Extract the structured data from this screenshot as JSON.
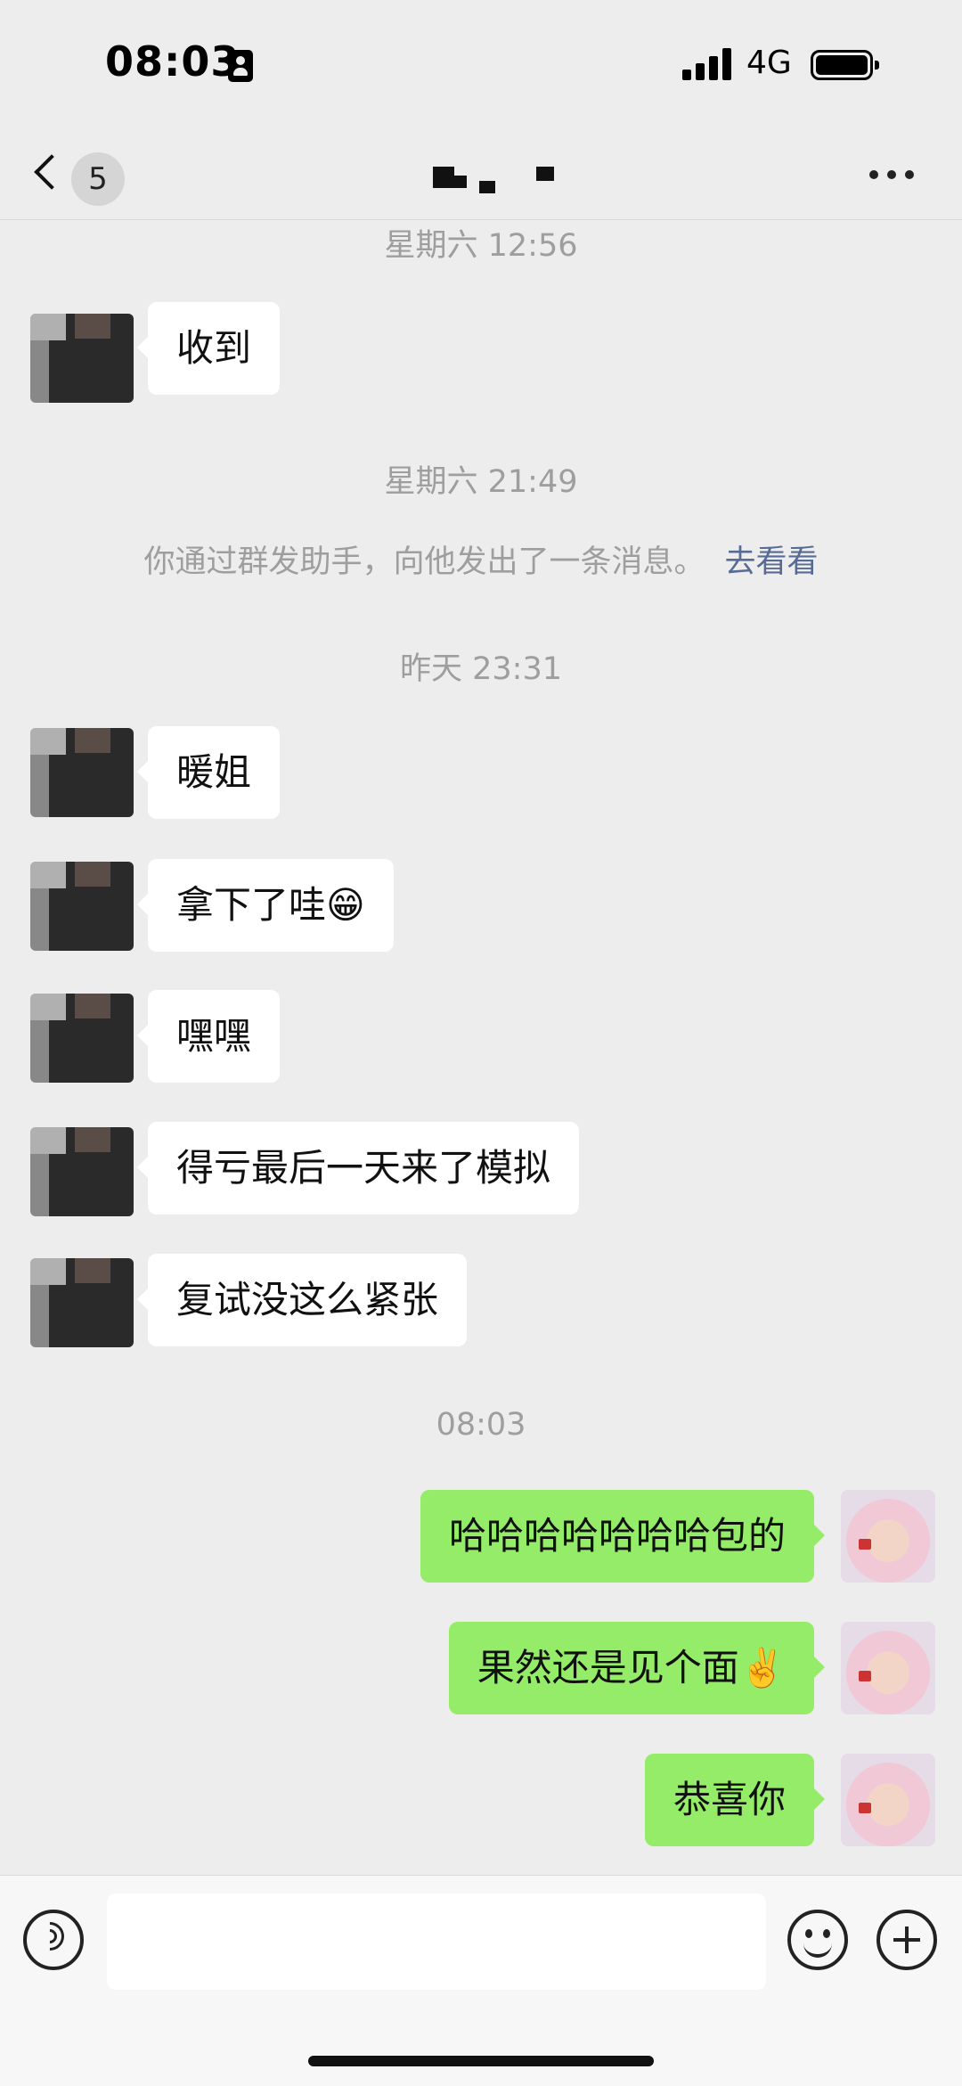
{
  "status_bar": {
    "time": "08:03",
    "network": "4G",
    "icons": [
      "id-card-icon",
      "signal-icon",
      "battery-icon"
    ]
  },
  "nav": {
    "unread_count": "5",
    "icons": [
      "back-arrow-icon",
      "more-icon"
    ]
  },
  "messages": [
    {
      "kind": "time",
      "text": "星期六 12:56"
    },
    {
      "kind": "in",
      "text": "收到"
    },
    {
      "kind": "time",
      "text": "星期六 21:49"
    },
    {
      "kind": "system",
      "text": "你通过群发助手，向他发出了一条消息。",
      "link": "去看看"
    },
    {
      "kind": "time",
      "text": "昨天 23:31"
    },
    {
      "kind": "in",
      "text": "暖姐"
    },
    {
      "kind": "in",
      "text": "拿下了哇😁"
    },
    {
      "kind": "in",
      "text": "嘿嘿"
    },
    {
      "kind": "in",
      "text": "得亏最后一天来了模拟"
    },
    {
      "kind": "in",
      "text": "复试没这么紧张"
    },
    {
      "kind": "time",
      "text": "08:03"
    },
    {
      "kind": "out",
      "text": "哈哈哈哈哈哈哈包的"
    },
    {
      "kind": "out",
      "text": "果然还是见个面✌️"
    },
    {
      "kind": "out",
      "text": "恭喜你"
    }
  ],
  "input_bar": {
    "placeholder": "",
    "icons": [
      "voice-icon",
      "emoji-icon",
      "plus-icon"
    ]
  },
  "colors": {
    "background": "#ededed",
    "incoming_bubble": "#ffffff",
    "outgoing_bubble": "#95ec69",
    "link": "#576b95",
    "timestamp": "#9e9e9e"
  }
}
